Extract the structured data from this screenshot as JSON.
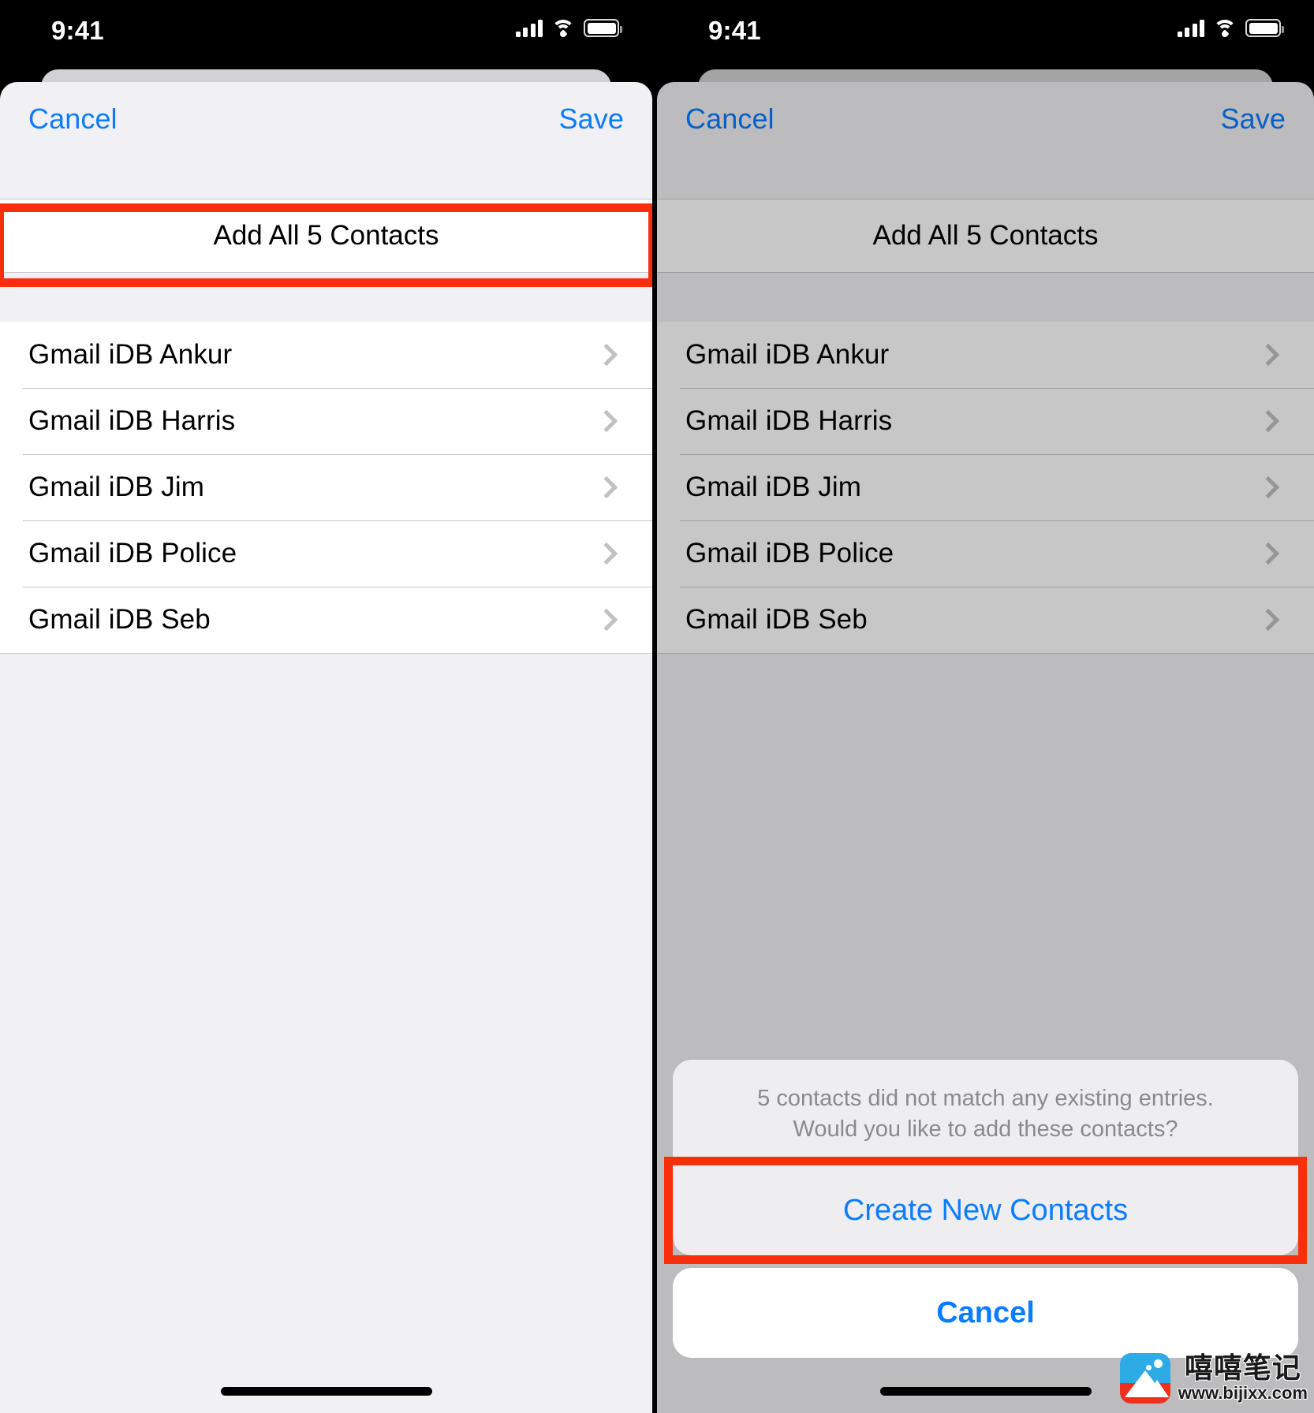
{
  "colors": {
    "accent_blue": "#0a7cff",
    "highlight_red": "#f92e0b",
    "sheet_bg": "#f1f1f5",
    "row_bg": "#ffffff",
    "dim_overlay": "rgba(0,0,0,0.22)"
  },
  "status_bar": {
    "time": "9:41",
    "signal_icon": "cellular-bars-icon",
    "wifi_icon": "wifi-icon",
    "battery_icon": "battery-full-icon"
  },
  "left_panel": {
    "nav": {
      "cancel_label": "Cancel",
      "save_label": "Save"
    },
    "primary_action_label": "Add All 5 Contacts",
    "contacts": [
      {
        "name": "Gmail iDB Ankur",
        "disclosure_icon": "chevron-right-icon"
      },
      {
        "name": "Gmail iDB Harris",
        "disclosure_icon": "chevron-right-icon"
      },
      {
        "name": "Gmail iDB Jim",
        "disclosure_icon": "chevron-right-icon"
      },
      {
        "name": "Gmail iDB Police",
        "disclosure_icon": "chevron-right-icon"
      },
      {
        "name": "Gmail iDB Seb",
        "disclosure_icon": "chevron-right-icon"
      }
    ],
    "highlight_target": "Add All 5 Contacts"
  },
  "right_panel": {
    "nav": {
      "cancel_label": "Cancel",
      "save_label": "Save"
    },
    "primary_action_label": "Add All 5 Contacts",
    "contacts": [
      {
        "name": "Gmail iDB Ankur",
        "disclosure_icon": "chevron-right-icon"
      },
      {
        "name": "Gmail iDB Harris",
        "disclosure_icon": "chevron-right-icon"
      },
      {
        "name": "Gmail iDB Jim",
        "disclosure_icon": "chevron-right-icon"
      },
      {
        "name": "Gmail iDB Police",
        "disclosure_icon": "chevron-right-icon"
      },
      {
        "name": "Gmail iDB Seb",
        "disclosure_icon": "chevron-right-icon"
      }
    ],
    "action_sheet": {
      "message_line1": "5 contacts did not match any existing entries.",
      "message_line2": "Would you like to add these contacts?",
      "create_label": "Create New Contacts",
      "cancel_label": "Cancel"
    },
    "highlight_target": "Create New Contacts"
  },
  "watermark": {
    "cn_text": "嘻嘻笔记",
    "url_text": "www.bijixx.com"
  }
}
